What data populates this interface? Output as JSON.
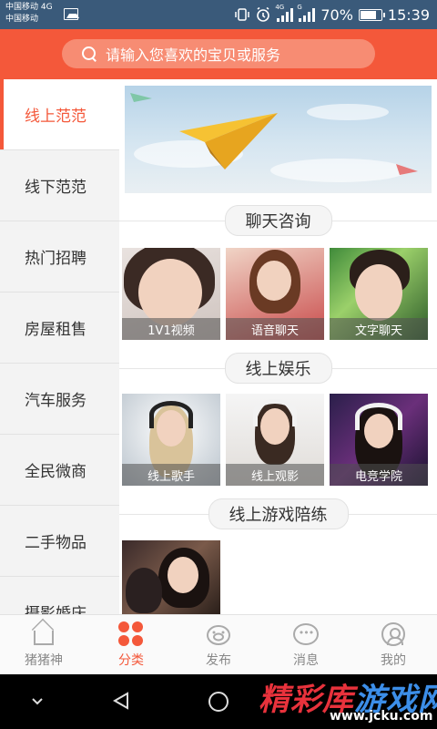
{
  "status_bar": {
    "carrier_line1": "中国移动 4G",
    "carrier_line2": "中国移动",
    "network_tag_1": "4G",
    "network_tag_2": "G",
    "battery_percent": "70%",
    "time": "15:39"
  },
  "search": {
    "placeholder": "请输入您喜欢的宝贝或服务"
  },
  "sidebar": {
    "items": [
      {
        "label": "线上范范",
        "active": true
      },
      {
        "label": "线下范范",
        "active": false
      },
      {
        "label": "热门招聘",
        "active": false
      },
      {
        "label": "房屋租售",
        "active": false
      },
      {
        "label": "汽车服务",
        "active": false
      },
      {
        "label": "全民微商",
        "active": false
      },
      {
        "label": "二手物品",
        "active": false
      },
      {
        "label": "摄影婚庆",
        "active": false
      }
    ]
  },
  "sections": [
    {
      "title": "聊天咨询",
      "items": [
        {
          "caption": "1V1视频"
        },
        {
          "caption": "语音聊天"
        },
        {
          "caption": "文字聊天"
        }
      ]
    },
    {
      "title": "线上娱乐",
      "items": [
        {
          "caption": "线上歌手"
        },
        {
          "caption": "线上观影"
        },
        {
          "caption": "电竞学院"
        }
      ]
    },
    {
      "title": "线上游戏陪练",
      "items": []
    }
  ],
  "bottom_nav": {
    "items": [
      {
        "label": "猪猪神",
        "icon": "home-icon",
        "active": false
      },
      {
        "label": "分类",
        "icon": "category-icon",
        "active": true
      },
      {
        "label": "发布",
        "icon": "publish-icon",
        "active": false
      },
      {
        "label": "消息",
        "icon": "message-icon",
        "active": false
      },
      {
        "label": "我的",
        "icon": "profile-icon",
        "active": false
      }
    ]
  },
  "watermark": {
    "text_part1": "精彩库",
    "text_part2": "游戏网",
    "url": "www.jcku.com"
  },
  "colors": {
    "accent": "#f4583a",
    "status_bar": "#3a5a7a"
  }
}
